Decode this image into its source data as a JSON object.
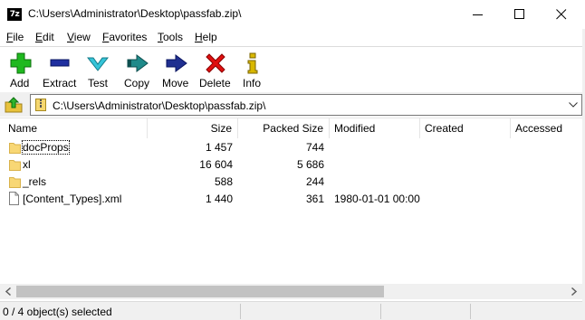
{
  "window": {
    "app_icon_text": "7z",
    "title": "C:\\Users\\Administrator\\Desktop\\passfab.zip\\"
  },
  "menu": [
    {
      "first": "F",
      "rest": "ile"
    },
    {
      "first": "E",
      "rest": "dit"
    },
    {
      "first": "V",
      "rest": "iew"
    },
    {
      "first": "F",
      "rest": "avorites"
    },
    {
      "first": "T",
      "rest": "ools"
    },
    {
      "first": "H",
      "rest": "elp"
    }
  ],
  "toolbar": {
    "add": "Add",
    "extract": "Extract",
    "test": "Test",
    "copy": "Copy",
    "move": "Move",
    "delete": "Delete",
    "info": "Info",
    "colors": {
      "add": "#1fb91f",
      "extract": "#1f2fa0",
      "test": "#35c4d8",
      "copy": "#1f8a8a",
      "move": "#1f2f90",
      "delete": "#e01010",
      "info": "#d9b800"
    }
  },
  "address": {
    "path": "C:\\Users\\Administrator\\Desktop\\passfab.zip\\"
  },
  "columns": [
    "Name",
    "Size",
    "Packed Size",
    "Modified",
    "Created",
    "Accessed"
  ],
  "rows": [
    {
      "icon": "folder-icon",
      "name": "docProps",
      "size": "1 457",
      "packed": "744",
      "modified": "",
      "created": "",
      "accessed": ""
    },
    {
      "icon": "folder-icon",
      "name": "xl",
      "size": "16 604",
      "packed": "5 686",
      "modified": "",
      "created": "",
      "accessed": ""
    },
    {
      "icon": "folder-icon",
      "name": "_rels",
      "size": "588",
      "packed": "244",
      "modified": "",
      "created": "",
      "accessed": ""
    },
    {
      "icon": "file-icon",
      "name": "[Content_Types].xml",
      "size": "1 440",
      "packed": "361",
      "modified": "1980-01-01 00:00",
      "created": "",
      "accessed": ""
    }
  ],
  "status": {
    "selection": "0 / 4 object(s) selected"
  }
}
